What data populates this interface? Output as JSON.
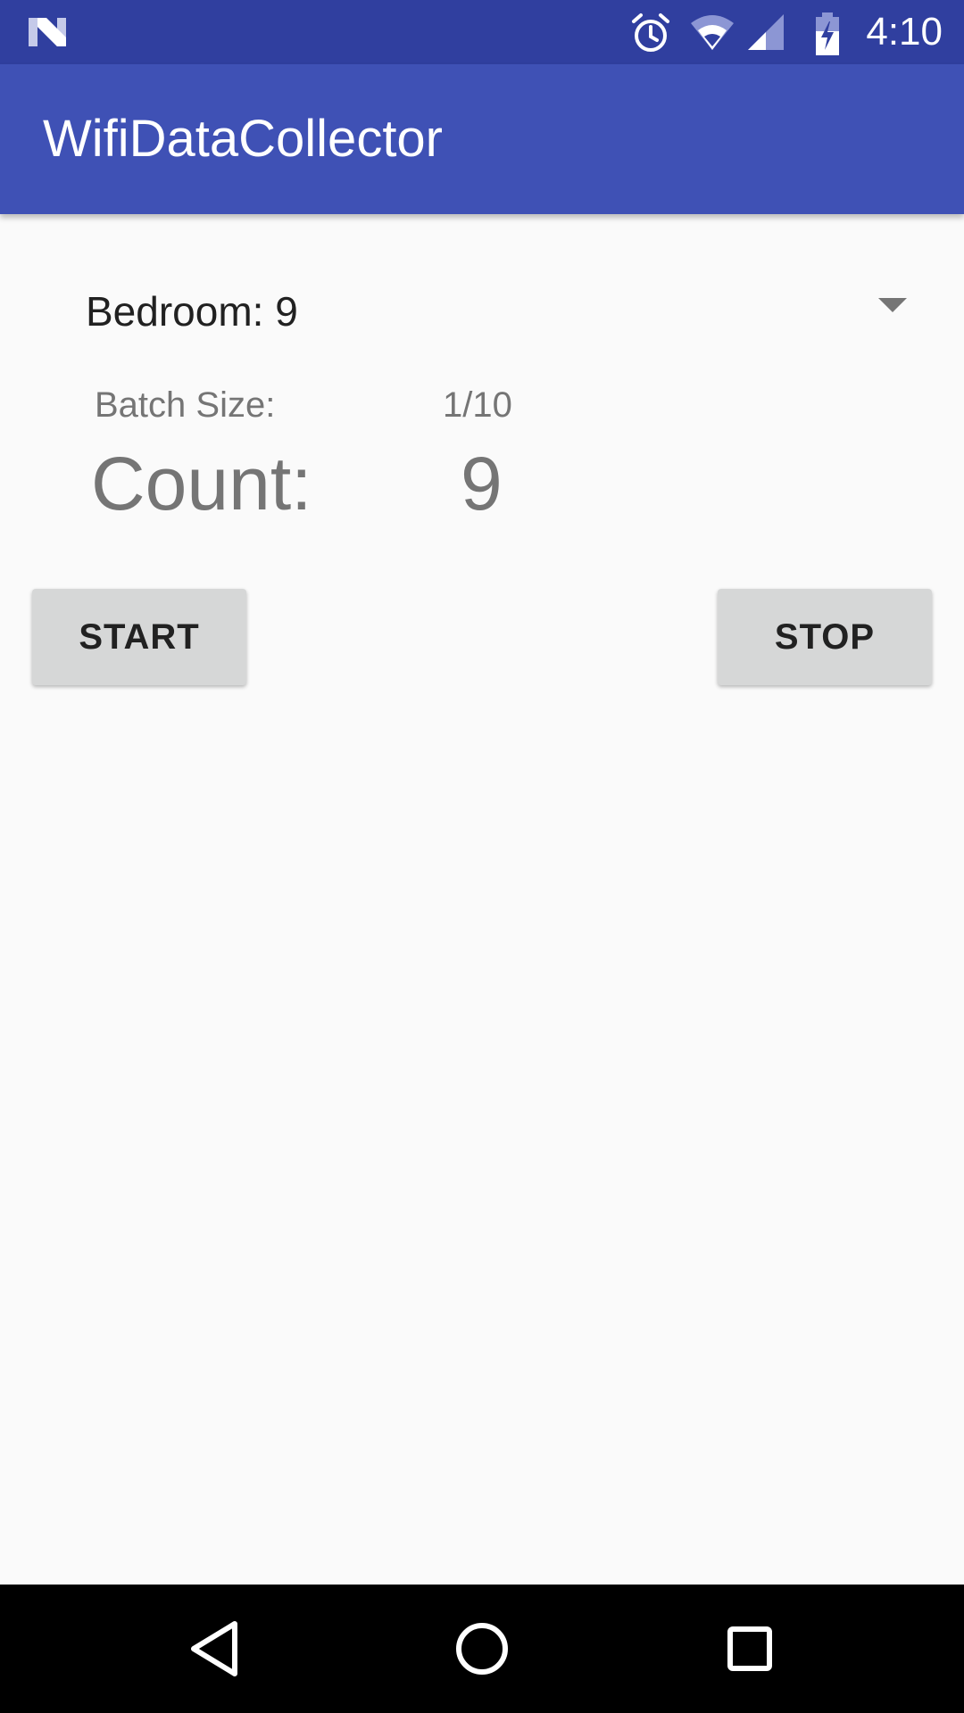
{
  "status_bar": {
    "time": "4:10",
    "icons": [
      "n-logo-icon",
      "alarm-icon",
      "wifi-icon",
      "signal-icon",
      "battery-charging-icon"
    ],
    "background_color": "#303f9f"
  },
  "app_bar": {
    "title": "WifiDataCollector",
    "background_color": "#3f51b5"
  },
  "room_spinner": {
    "selected": "Bedroom: 9",
    "arrow_icon": "dropdown-arrow-icon"
  },
  "batch": {
    "label": "Batch Size:",
    "value": "1/10"
  },
  "count": {
    "label": "Count:",
    "value": "9"
  },
  "buttons": {
    "start_label": "START",
    "stop_label": "STOP"
  },
  "nav_bar": {
    "icons": [
      "back-icon",
      "home-icon",
      "recents-icon"
    ]
  }
}
